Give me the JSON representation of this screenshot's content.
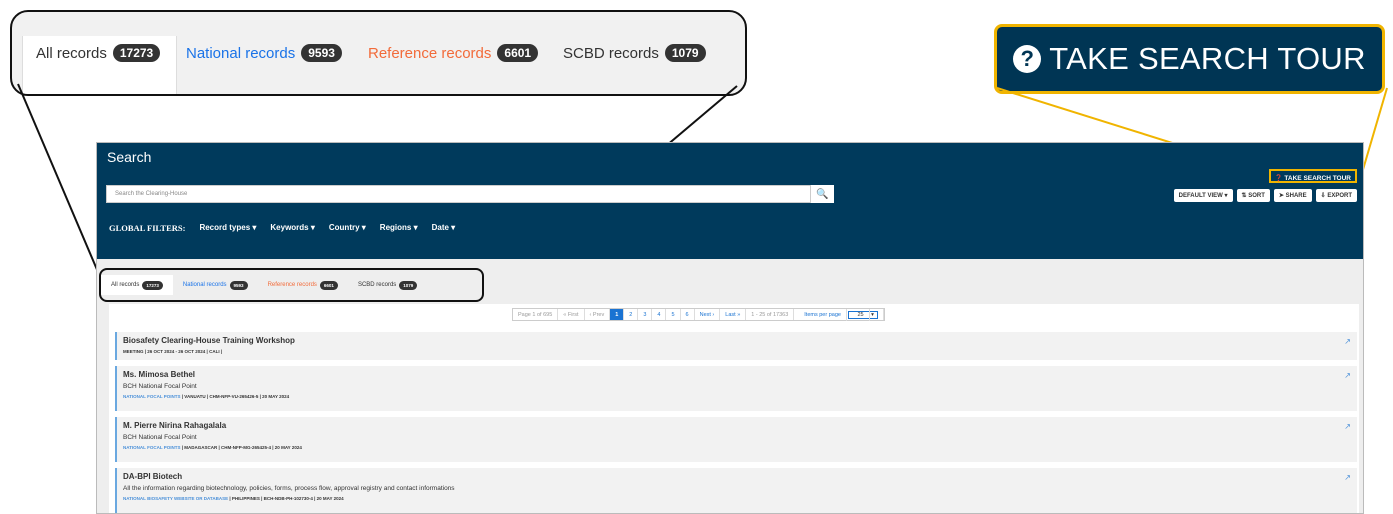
{
  "zoom_tabs": {
    "tabs": [
      {
        "label": "All records",
        "count": "17273",
        "color": "#333333"
      },
      {
        "label": "National records",
        "count": "9593",
        "color": "#1a73e8"
      },
      {
        "label": "Reference records",
        "count": "6601",
        "color": "#f26b3a"
      },
      {
        "label": "SCBD records",
        "count": "1079",
        "color": "#333333"
      }
    ]
  },
  "zoom_tour": {
    "icon": "?",
    "label": "TAKE SEARCH TOUR"
  },
  "header": {
    "title": "Search",
    "search_placeholder": "Search the Clearing-House",
    "tour_label": "TAKE SEARCH TOUR",
    "controls": [
      "DEFAULT VIEW",
      "SORT",
      "SHARE",
      "EXPORT"
    ],
    "filters_label": "GLOBAL FILTERS:",
    "filters": [
      "Record types",
      "Keywords",
      "Country",
      "Regions",
      "Date"
    ]
  },
  "tabs": [
    {
      "label": "All records",
      "count": "17273",
      "color": "#333333"
    },
    {
      "label": "National records",
      "count": "9593",
      "color": "#1a73e8"
    },
    {
      "label": "Reference records",
      "count": "6601",
      "color": "#f26b3a"
    },
    {
      "label": "SCBD records",
      "count": "1079",
      "color": "#333333"
    }
  ],
  "pager": {
    "page_info": "Page 1 of 695",
    "first": "« First",
    "prev": "‹ Prev",
    "pages": [
      "1",
      "2",
      "3",
      "4",
      "5",
      "6"
    ],
    "next": "Next ›",
    "last": "Last »",
    "range": "1 - 25 of 17363",
    "ipp_label": "Items per page",
    "ipp_value": "25"
  },
  "records": [
    {
      "title": "Biosafety Clearing-House Training Workshop",
      "subtitle": "",
      "meta_type": "MEETING",
      "meta": "26 OCT 2024 - 26 OCT 2024 | CALI |"
    },
    {
      "title": "Ms. Mimosa Bethel",
      "subtitle": "BCH National Focal Point",
      "meta_type": "NATIONAL FOCAL POINTS",
      "meta": "VANUATU | CHM-NFP-VU-265426-5 | 20 MAY 2024"
    },
    {
      "title": "M. Pierre Nirina Rahagalala",
      "subtitle": "BCH National Focal Point",
      "meta_type": "NATIONAL FOCAL POINTS",
      "meta": "MADAGASCAR | CHM-NFP-MG-265425-4 | 20 MAY 2024"
    },
    {
      "title": "DA-BPI Biotech",
      "subtitle": "All the information regarding biotechnology, policies, forms, process flow, approval registry and contact informations",
      "meta_type": "NATIONAL BIOSAFETY WEBSITE OR DATABASE",
      "meta": "PHILIPPINES | BCH-NDB-PH-102730-4 | 20 MAY 2024"
    }
  ]
}
